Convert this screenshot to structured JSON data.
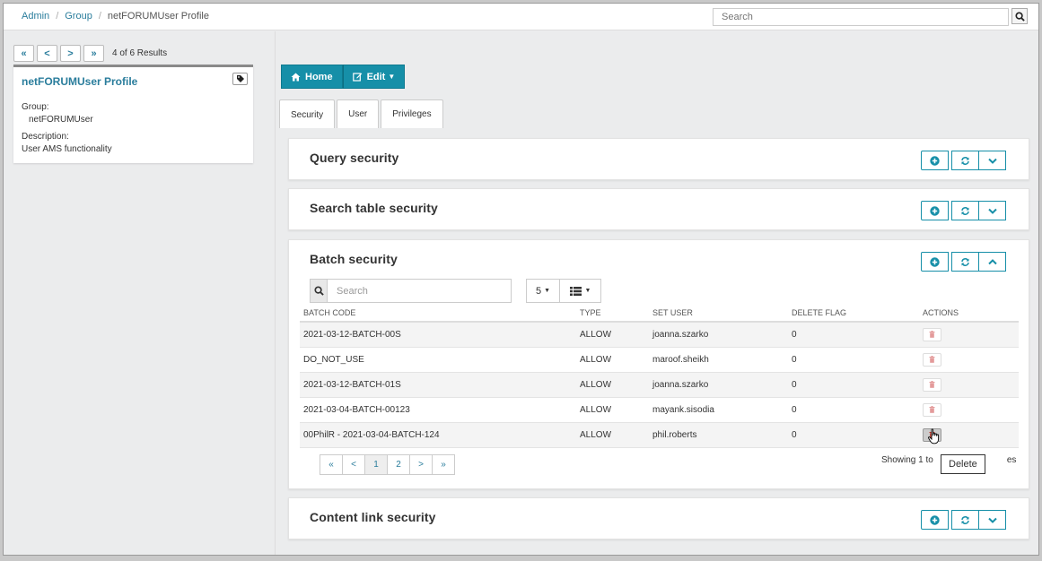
{
  "breadcrumb": [
    "Admin",
    "Group",
    "netFORUMUser Profile"
  ],
  "top_search": {
    "placeholder": "Search"
  },
  "nav": {
    "first": "«",
    "prev": "<",
    "next": ">",
    "last": "»",
    "results": "4 of 6 Results"
  },
  "card": {
    "title": "netFORUMUser Profile",
    "group_label": "Group:",
    "group_value": "netFORUMUser",
    "description_label": "Description:",
    "description_value": "User AMS functionality"
  },
  "toolbar": {
    "home": "Home",
    "edit": "Edit"
  },
  "tabs": [
    "Security",
    "User",
    "Privileges"
  ],
  "panels": {
    "query": "Query security",
    "search_table": "Search table security",
    "batch": "Batch security",
    "content_link": "Content link security"
  },
  "batch": {
    "search_placeholder": "Search",
    "page_size": "5",
    "columns": [
      "BATCH CODE",
      "TYPE",
      "SET USER",
      "DELETE FLAG",
      "ACTIONS"
    ],
    "rows": [
      {
        "code": "2021-03-12-BATCH-00S",
        "type": "ALLOW",
        "user": "joanna.szarko",
        "flag": "0"
      },
      {
        "code": "DO_NOT_USE",
        "type": "ALLOW",
        "user": "maroof.sheikh",
        "flag": "0"
      },
      {
        "code": "2021-03-12-BATCH-01S",
        "type": "ALLOW",
        "user": "joanna.szarko",
        "flag": "0"
      },
      {
        "code": "2021-03-04-BATCH-00123",
        "type": "ALLOW",
        "user": "mayank.sisodia",
        "flag": "0"
      },
      {
        "code": "00PhilR - 2021-03-04-BATCH-124",
        "type": "ALLOW",
        "user": "phil.roberts",
        "flag": "0"
      }
    ],
    "pager": [
      "«",
      "<",
      "1",
      "2",
      ">",
      "»"
    ],
    "showing": "Showing 1 to",
    "showing_tail": "es",
    "tooltip": "Delete"
  },
  "colors": {
    "accent": "#168fa8",
    "link": "#2a7d9c",
    "delete_icon": "#e39a9a"
  }
}
